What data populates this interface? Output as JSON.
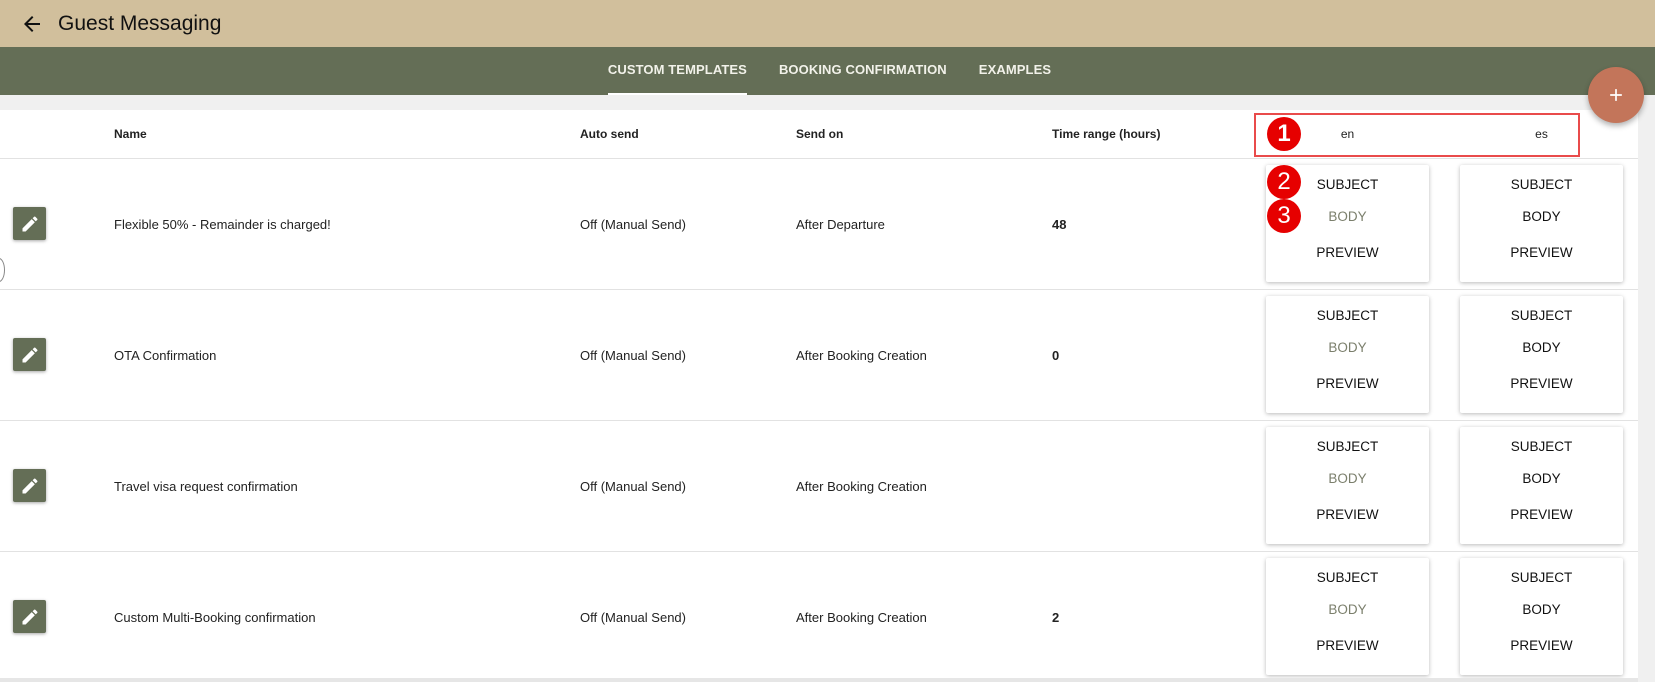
{
  "app": {
    "title": "Guest Messaging"
  },
  "tabs": [
    "CUSTOM TEMPLATES",
    "BOOKING CONFIRMATION",
    "EXAMPLES"
  ],
  "active_tab": "CUSTOM TEMPLATES",
  "table": {
    "headers": {
      "name": "Name",
      "auto_send": "Auto send",
      "send_on": "Send on",
      "time_range": "Time range (hours)",
      "languages": [
        "en",
        "es"
      ]
    },
    "rows": [
      {
        "name": "Flexible 50% - Remainder is charged!",
        "auto_send": "Off (Manual Send)",
        "send_on": "After Departure",
        "time_range": "48"
      },
      {
        "name": "OTA Confirmation",
        "auto_send": "Off (Manual Send)",
        "send_on": "After Booking Creation",
        "time_range": "0"
      },
      {
        "name": "Travel visa request confirmation",
        "auto_send": "Off (Manual Send)",
        "send_on": "After Booking Creation",
        "time_range": ""
      },
      {
        "name": "Custom Multi-Booking confirmation",
        "auto_send": "Off (Manual Send)",
        "send_on": "After Booking Creation",
        "time_range": "2"
      }
    ],
    "card_buttons": {
      "subject": "SUBJECT",
      "body": "BODY",
      "preview": "PREVIEW"
    }
  },
  "annotations": [
    "1",
    "2",
    "3"
  ],
  "colors": {
    "topbar": "#d1bf9c",
    "tabbar": "#646e56",
    "fab": "#c3755a",
    "edit_button": "#646e56",
    "annotation_marker": "#e60000",
    "highlight_box": "#e94b4b"
  },
  "icons": {
    "back": "arrow-left-icon",
    "add": "plus-icon",
    "edit": "pencil-icon"
  }
}
